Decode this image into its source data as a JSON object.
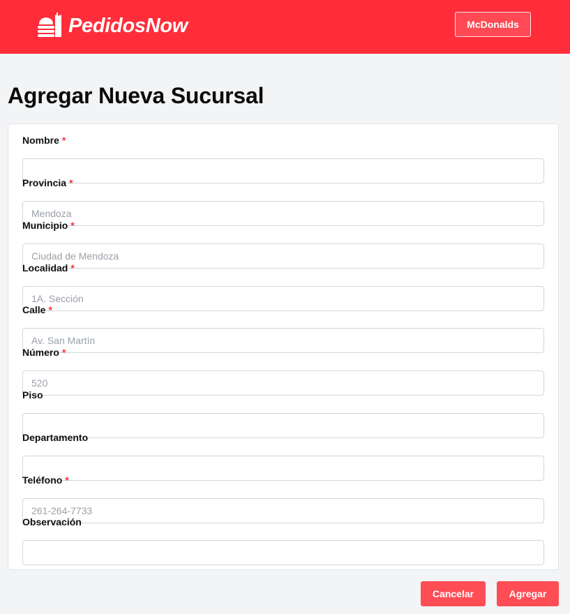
{
  "header": {
    "brand": "PedidosNow",
    "store_button_label": "McDonalds",
    "logo_icon": "food-stack-icon",
    "accent_color": "#ff2d3a"
  },
  "page": {
    "title": "Agregar Nueva Sucursal"
  },
  "form": {
    "fields": [
      {
        "label": "Nombre",
        "required": "*",
        "value": "",
        "placeholder": ""
      },
      {
        "label": "Provincia",
        "required": "*",
        "value": "",
        "placeholder": "Mendoza"
      },
      {
        "label": "Municipio",
        "required": "*",
        "value": "",
        "placeholder": "Ciudad de Mendoza"
      },
      {
        "label": "Localidad",
        "required": "*",
        "value": "",
        "placeholder": "1A. Sección"
      },
      {
        "label": "Calle",
        "required": "*",
        "value": "",
        "placeholder": "Av. San Martín"
      },
      {
        "label": "Número",
        "required": "*",
        "value": "",
        "placeholder": "520"
      },
      {
        "label": "Piso",
        "required": "",
        "value": "",
        "placeholder": ""
      },
      {
        "label": "Departamento",
        "required": "",
        "value": "",
        "placeholder": ""
      },
      {
        "label": "Teléfono",
        "required": "*",
        "value": "",
        "placeholder": "261-264-7733"
      },
      {
        "label": "Observación",
        "required": "",
        "value": "",
        "placeholder": ""
      }
    ]
  },
  "actions": {
    "cancel_label": "Cancelar",
    "submit_label": "Agregar"
  }
}
